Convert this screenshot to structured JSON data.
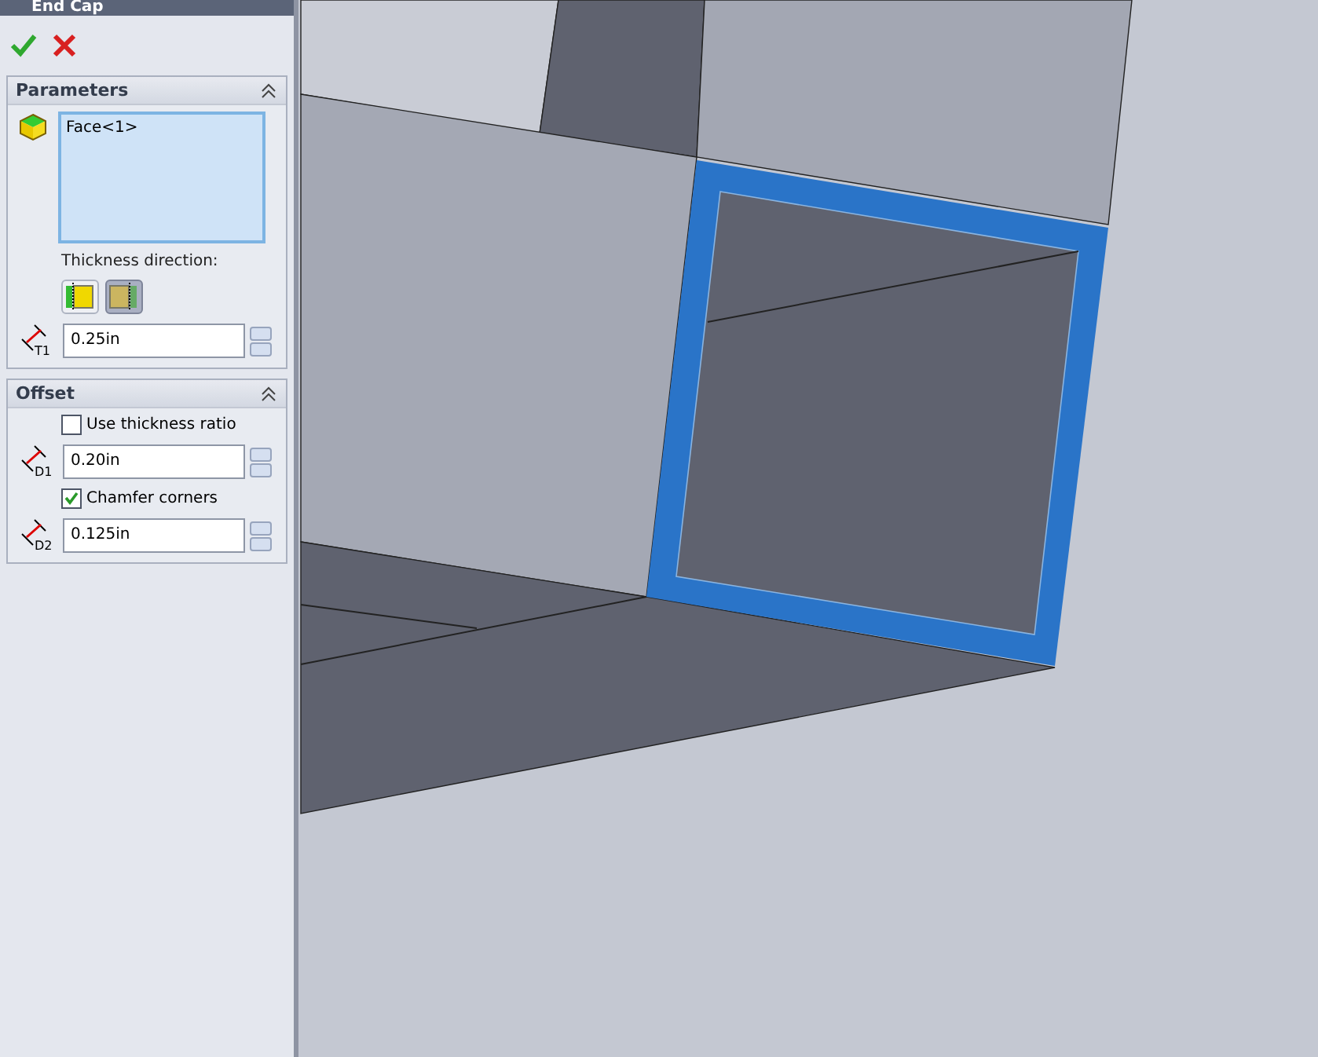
{
  "window": {
    "title": "End Cap"
  },
  "parameters": {
    "title": "Parameters",
    "expanded": true,
    "selection": [
      "Face<1>"
    ],
    "thickness_direction_label": "Thickness direction:",
    "directions": [
      {
        "selected": false
      },
      {
        "selected": true
      }
    ],
    "thickness": {
      "icon_label": "T1",
      "value": "0.25in"
    }
  },
  "offset": {
    "title": "Offset",
    "expanded": true,
    "use_thickness_ratio": {
      "label": "Use thickness ratio",
      "checked": false
    },
    "offset_distance": {
      "icon_label": "D1",
      "value": "0.20in"
    },
    "chamfer_corners": {
      "label": "Chamfer corners",
      "checked": true
    },
    "chamfer_distance": {
      "icon_label": "D2",
      "value": "0.125in"
    }
  }
}
